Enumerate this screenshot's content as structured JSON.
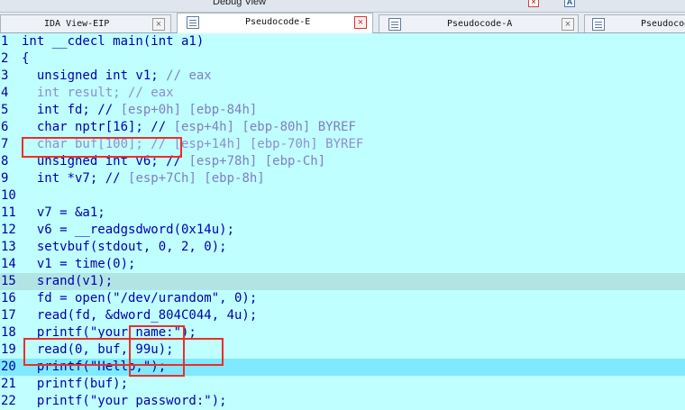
{
  "window": {
    "top_tab_label": "Debug View",
    "top_close_glyph": "×",
    "top_icon_glyph": "A"
  },
  "tabs": [
    {
      "label": "IDA View-EIP",
      "active": false,
      "close": "×",
      "icon": "ida-view-icon"
    },
    {
      "label": "Pseudocode-E",
      "active": true,
      "close": "×",
      "icon": "pseudocode-icon"
    },
    {
      "label": "Pseudocode-A",
      "active": false,
      "close": "×",
      "icon": "pseudocode-icon"
    },
    {
      "label": "Pseudocode-",
      "active": false,
      "close": "",
      "icon": "pseudocode-icon"
    }
  ],
  "code_lines": [
    {
      "n": "1",
      "code": "int __cdecl main(int a1)",
      "comment": ""
    },
    {
      "n": "2",
      "code": "{",
      "comment": ""
    },
    {
      "n": "3",
      "code": "  unsigned int v1; ",
      "comment": "// eax"
    },
    {
      "n": "4",
      "code": "  int result; // eax",
      "comment": "",
      "greyed": true
    },
    {
      "n": "5",
      "code": "  int fd; // ",
      "comment": "[esp+0h] [ebp-84h]"
    },
    {
      "n": "6",
      "code": "  char nptr[16]; // ",
      "comment": "[esp+4h] [ebp-80h] BYREF"
    },
    {
      "n": "7",
      "code": "  char buf[100]; // ",
      "comment": "[esp+14h] [ebp-70h] BYREF",
      "greyed": true
    },
    {
      "n": "8",
      "code": "  unsigned int v6; // ",
      "comment": "[esp+78h] [ebp-Ch]"
    },
    {
      "n": "9",
      "code": "  int *v7; // ",
      "comment": "[esp+7Ch] [ebp-8h]"
    },
    {
      "n": "10",
      "code": "",
      "comment": ""
    },
    {
      "n": "11",
      "code": "  v7 = &a1;",
      "comment": ""
    },
    {
      "n": "12",
      "code": "  v6 = __readgsdword(0x14u);",
      "comment": ""
    },
    {
      "n": "13",
      "code": "  setvbuf(stdout, 0, 2, 0);",
      "comment": ""
    },
    {
      "n": "14",
      "code": "  v1 = time(0);",
      "comment": ""
    },
    {
      "n": "15",
      "code": "  srand(v1);",
      "comment": "",
      "highlight": "cursor"
    },
    {
      "n": "16",
      "code": "  fd = open(\"/dev/urandom\", 0);",
      "comment": ""
    },
    {
      "n": "17",
      "code": "  read(fd, &dword_804C044, 4u);",
      "comment": ""
    },
    {
      "n": "18",
      "code": "  printf(\"your name:\");",
      "comment": ""
    },
    {
      "n": "19",
      "code": "  read(0, buf, 99u);",
      "comment": ""
    },
    {
      "n": "20",
      "code": "  printf(\"Hello,\");",
      "comment": "",
      "highlight": "current"
    },
    {
      "n": "21",
      "code": "  printf(buf);",
      "comment": ""
    },
    {
      "n": "22",
      "code": "  printf(\"your password:\");",
      "comment": ""
    }
  ],
  "colors": {
    "code_bg": "#c0ffff",
    "current_line": "#7fe9ff",
    "cursor_line": "#b2e4e4",
    "annotation_box": "#e8302a",
    "keyword": "#0000b0",
    "comment": "#7f80c0"
  }
}
